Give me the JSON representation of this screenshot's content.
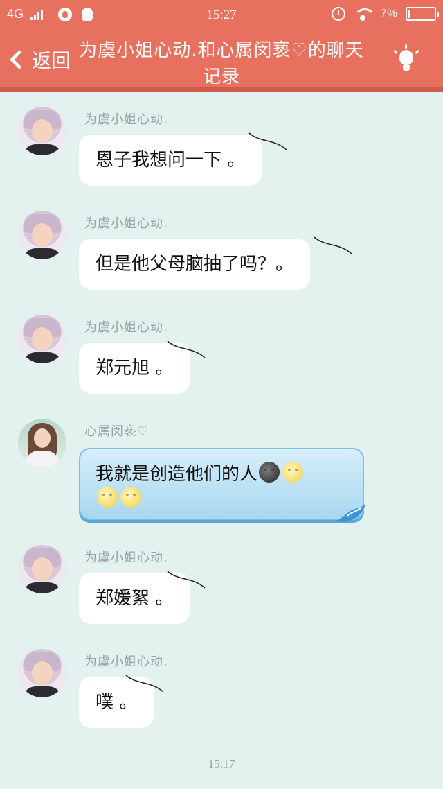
{
  "status_bar": {
    "network": "4G",
    "time": "15:27",
    "battery": "7%"
  },
  "header": {
    "back_label": "返回",
    "title": "为虞小姐心动.和心属闵亵♡的聊天记录",
    "bulb_icon": "lightbulb-icon"
  },
  "messages": [
    {
      "sender": "为虞小姐心动.",
      "text": "恩子我想问一下 。"
    },
    {
      "sender": "为虞小姐心动.",
      "text": "但是他父母脑抽了吗？。"
    },
    {
      "sender": "为虞小姐心动.",
      "text": "郑元旭 。"
    },
    {
      "sender": "心属闵亵♡",
      "text_line1": "我就是创造他们的人",
      "emojis": [
        "new-moon-face",
        "full-moon-face",
        "full-moon-face",
        "full-moon-face"
      ]
    },
    {
      "sender": "为虞小姐心动.",
      "text": "郑媛絮 。"
    },
    {
      "sender": "为虞小姐心动.",
      "text": "噗 。"
    }
  ],
  "footer_time": "15:17",
  "colors": {
    "accent": "#e8705e",
    "background": "#e3f2ef",
    "bubble_blue": "#a8d7f0"
  }
}
